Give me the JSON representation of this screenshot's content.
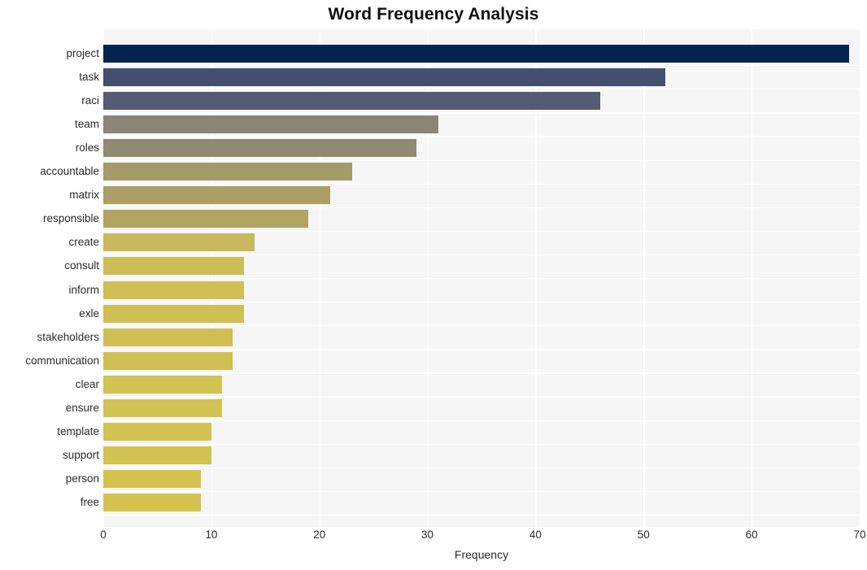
{
  "chart_data": {
    "type": "bar",
    "orientation": "horizontal",
    "title": "Word Frequency Analysis",
    "xlabel": "Frequency",
    "ylabel": "",
    "categories": [
      "project",
      "task",
      "raci",
      "team",
      "roles",
      "accountable",
      "matrix",
      "responsible",
      "create",
      "consult",
      "inform",
      "exle",
      "stakeholders",
      "communication",
      "clear",
      "ensure",
      "template",
      "support",
      "person",
      "free"
    ],
    "values": [
      69,
      52,
      46,
      31,
      29,
      23,
      21,
      19,
      14,
      13,
      13,
      13,
      12,
      12,
      11,
      11,
      10,
      10,
      9,
      9
    ],
    "bar_colors": [
      "#042450",
      "#434f6f",
      "#565b71",
      "#898679",
      "#8f8b72",
      "#a59a69",
      "#ab9f66",
      "#b0a462",
      "#c6b85b",
      "#cdbd57",
      "#cfbf55",
      "#cfbf55",
      "#d0c053",
      "#d0c053",
      "#d2c251",
      "#d2c251",
      "#d3c350",
      "#d3c350",
      "#d4c44f",
      "#d4c44f"
    ],
    "xlim": [
      0,
      70
    ],
    "xticks": [
      0,
      10,
      20,
      30,
      40,
      50,
      60,
      70
    ],
    "xtick_labels": [
      "0",
      "10",
      "20",
      "30",
      "40",
      "50",
      "60",
      "70"
    ],
    "grid": true,
    "grid_color": "#ffffff",
    "plot_background": "#f6f6f6",
    "figure_background": "#ffffff",
    "legend": null
  }
}
